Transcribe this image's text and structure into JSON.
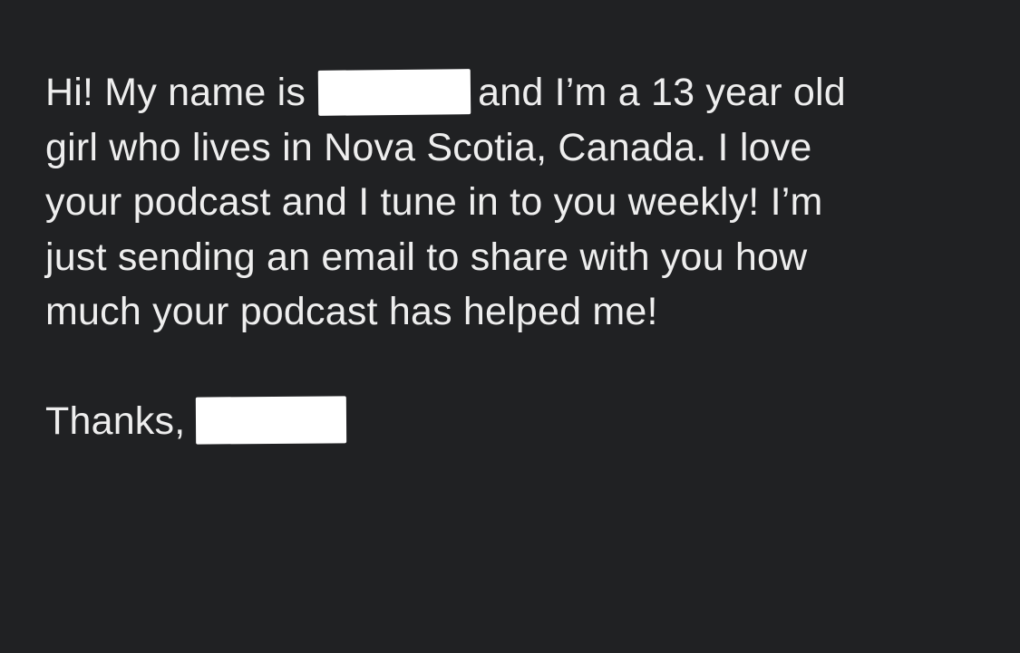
{
  "message": {
    "line1_before": "Hi! My name is",
    "line1_after": "and I’m a 13 year old",
    "line2": "girl who lives in Nova Scotia, Canada. I love",
    "line3": "your podcast and I tune in to you weekly! I’m",
    "line4": "just sending an email to share with you how",
    "line5": "much your podcast has helped me!",
    "closing": "Thanks,"
  },
  "colors": {
    "background": "#202123",
    "text": "#eeeeee",
    "redaction": "#ffffff"
  }
}
